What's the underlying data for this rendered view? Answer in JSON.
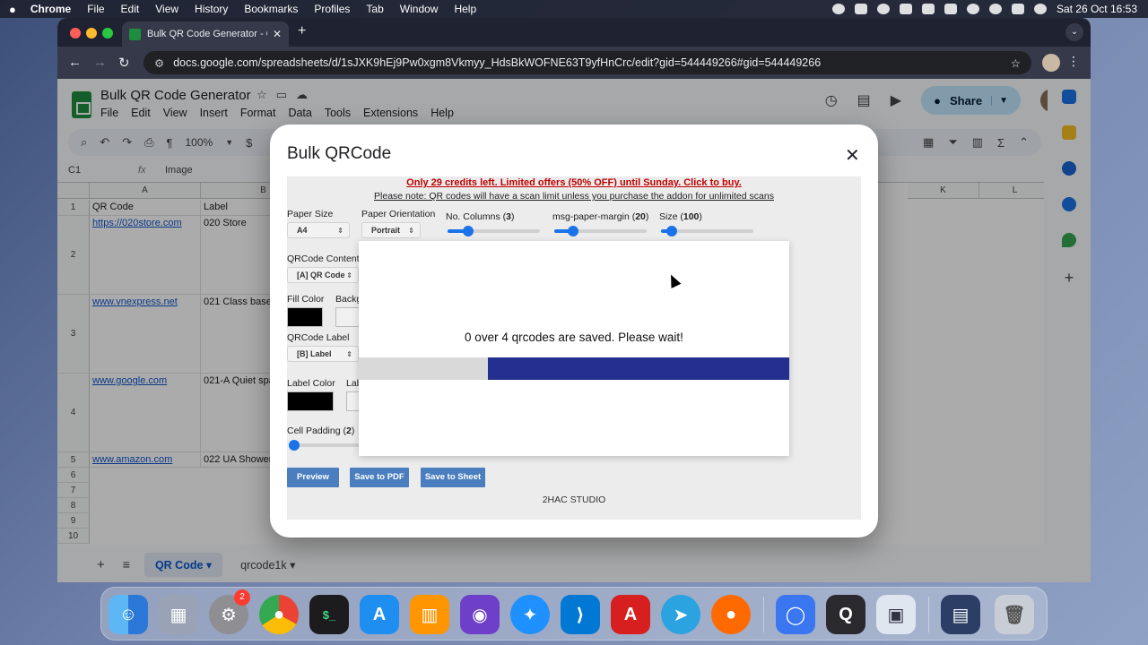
{
  "menubar": {
    "items": [
      "Chrome",
      "File",
      "Edit",
      "View",
      "History",
      "Bookmarks",
      "Profiles",
      "Tab",
      "Window",
      "Help"
    ],
    "clock": "Sat 26 Oct  16:53"
  },
  "browser": {
    "tab_title": "Bulk QR Code Generator - Go",
    "url": "docs.google.com/spreadsheets/d/1sJXK9hEj9Pw0xgm8Vkmyy_HdsBkWOFNE63T9yfHnCrc/edit?gid=544449266#gid=544449266"
  },
  "sheets": {
    "title": "Bulk QR Code Generator",
    "menu": [
      "File",
      "Edit",
      "View",
      "Insert",
      "Format",
      "Data",
      "Tools",
      "Extensions",
      "Help"
    ],
    "share_label": "Share",
    "zoom": "100%",
    "currency": "$",
    "name_box": "C1",
    "formula": "Image",
    "columns": [
      "A",
      "B",
      "K",
      "L"
    ],
    "rows": [
      {
        "n": "1",
        "a": "QR Code",
        "b": "Label"
      },
      {
        "n": "2",
        "a": "https://020store.com",
        "b": "020 Store"
      },
      {
        "n": "3",
        "a": "www.vnexpress.net",
        "b": "021 Class base 4"
      },
      {
        "n": "4",
        "a": "www.google.com",
        "b": "021-A Quiet spa"
      },
      {
        "n": "5",
        "a": "www.amazon.com",
        "b": "022 UA Shower"
      },
      {
        "n": "6",
        "a": "",
        "b": ""
      },
      {
        "n": "7",
        "a": "",
        "b": ""
      },
      {
        "n": "8",
        "a": "",
        "b": ""
      },
      {
        "n": "9",
        "a": "",
        "b": ""
      },
      {
        "n": "10",
        "a": "",
        "b": ""
      }
    ],
    "sheet_tabs": [
      "QR Code",
      "qrcode1k"
    ]
  },
  "modal": {
    "title": "Bulk QRCode",
    "offer": "Only 29 credits left. Limited offers (50% OFF) until Sunday. Click to buy.",
    "note": "Please note: QR codes will have a scan limit unless you purchase the addon for unlimited scans",
    "paper_size_label": "Paper Size",
    "paper_size_value": "A4",
    "orientation_label": "Paper Orientation",
    "orientation_value": "Portrait",
    "columns_label": "No. Columns",
    "columns_value": "3",
    "margin_label": "msg-paper-margin",
    "margin_value": "20",
    "size_label": "Size",
    "size_value": "100",
    "content_label": "QRCode Content",
    "content_value": "[A] QR Code",
    "fill_color_label": "Fill Color",
    "background_label": "Backg",
    "qr_label_label": "QRCode Label",
    "qr_label_value": "[B] Label",
    "label_color_label": "Label Color",
    "label_label_cut": "Lab",
    "cell_padding_label": "Cell Padding",
    "cell_padding_value": "2",
    "preview_label": "Preview",
    "save_pdf_label": "Save to PDF",
    "save_sheet_label": "Save to Sheet",
    "footer": "2HAC STUDIO",
    "progress_message": "0 over 4 qrcodes are saved. Please wait!",
    "progress_fraction": 0.7,
    "sliders": {
      "columns": 0.22,
      "margin": 0.2,
      "size": 0.12,
      "padding": 0.05
    },
    "colors": {
      "fill": "#000000",
      "background": "#f0f0f0",
      "label": "#000000",
      "accent": "#1a73e8",
      "progress": "#23308f"
    }
  },
  "dock": {
    "badge": "2"
  }
}
